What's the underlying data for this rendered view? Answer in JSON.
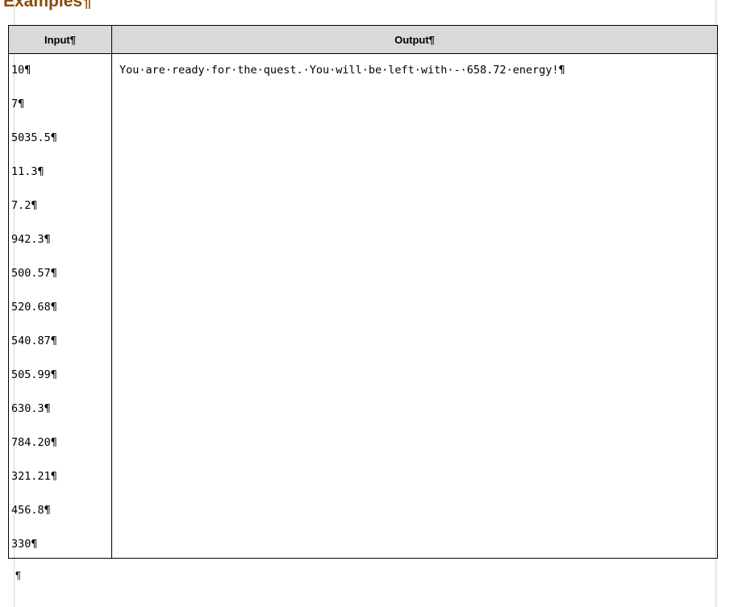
{
  "heading": "Examples¶",
  "table": {
    "headers": {
      "input": "Input¶",
      "output": "Output¶"
    },
    "input_lines": [
      "10¶",
      "7¶",
      "5035.5¶",
      "11.3¶",
      "7.2¶",
      "942.3¶",
      "500.57¶",
      "520.68¶",
      "540.87¶",
      "505.99¶",
      "630.3¶",
      "784.20¶",
      "321.21¶",
      "456.8¶",
      "330¶"
    ],
    "output_lines": [
      "You·are·ready·for·the·quest.·You·will·be·left·with·-·658.72·energy!¶"
    ]
  },
  "trailing_mark": "¶",
  "colors": {
    "heading": "#8b4a0c",
    "header_fill": "#d9d9d9",
    "border": "#000000"
  }
}
